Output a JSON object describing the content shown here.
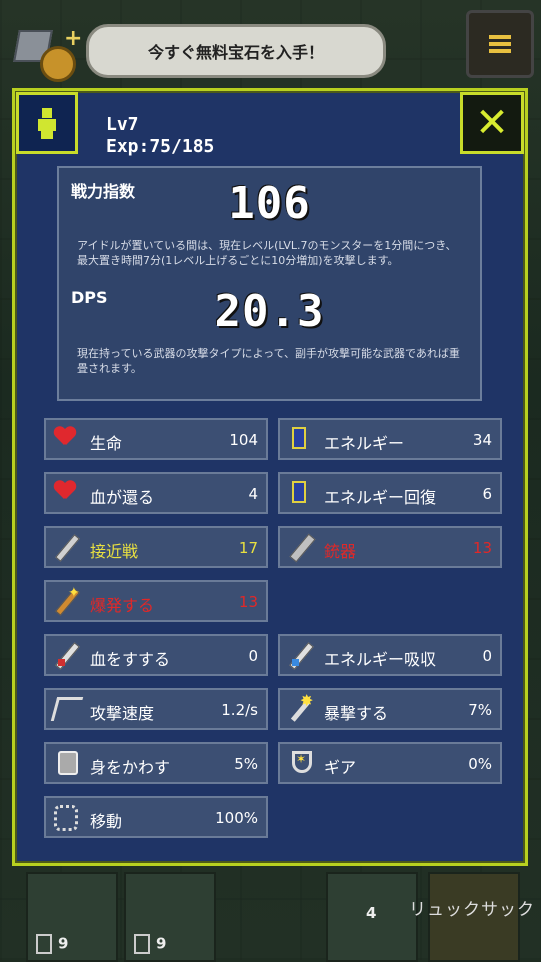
{
  "top_bar": {
    "offer_button": "今すぐ無料宝石を入手！"
  },
  "player": {
    "level": "Lv7",
    "exp": "Exp:75/185"
  },
  "close_label": "✕",
  "power": {
    "label": "戦力指数",
    "value": "106",
    "description": "アイドルが置いている間は、現在レベル(LVL.7のモンスターを1分間につき、最大置き時間7分(1レベル上げるごとに10分増加)を攻撃します。"
  },
  "dps": {
    "label": "DPS",
    "value": "20.3",
    "description": "現在持っている武器の攻撃タイプによって、副手が攻撃可能な武器であれば重畳されます。"
  },
  "stats": [
    {
      "name": "生命",
      "value": "104",
      "icon": "heart-icon",
      "color": "#ffffff"
    },
    {
      "name": "エネルギー",
      "value": "34",
      "icon": "energy-icon",
      "color": "#ffffff"
    },
    {
      "name": "血が還る",
      "value": "4",
      "icon": "heart-plus-icon",
      "color": "#ffffff"
    },
    {
      "name": "エネルギー回復",
      "value": "6",
      "icon": "energy-plus-icon",
      "color": "#ffffff"
    },
    {
      "name": "接近戦",
      "value": "17",
      "icon": "sword-icon",
      "color": "#e8e040"
    },
    {
      "name": "銃器",
      "value": "13",
      "icon": "gun-icon",
      "color": "#e02828"
    },
    {
      "name": "爆発する",
      "value": "13",
      "icon": "wand-icon",
      "color": "#e02828"
    },
    {
      "name": "血をすする",
      "value": "0",
      "icon": "dagger-red-icon",
      "color": "#ffffff"
    },
    {
      "name": "エネルギー吸収",
      "value": "0",
      "icon": "dagger-blue-icon",
      "color": "#ffffff"
    },
    {
      "name": "攻撃速度",
      "value": "1.2/s",
      "icon": "speed-icon",
      "color": "#ffffff"
    },
    {
      "name": "暴撃する",
      "value": "7%",
      "icon": "crit-icon",
      "color": "#ffffff"
    },
    {
      "name": "身をかわす",
      "value": "5%",
      "icon": "boot-icon",
      "color": "#ffffff"
    },
    {
      "name": "ギア",
      "value": "0%",
      "icon": "shield-icon",
      "color": "#ffffff"
    },
    {
      "name": "移動",
      "value": "100%",
      "icon": "runner-icon",
      "color": "#ffffff"
    }
  ],
  "bottom": {
    "slot1_count": "9",
    "slot2_count": "9",
    "slot3_count": "4",
    "backpack_label": "リュックサック"
  }
}
